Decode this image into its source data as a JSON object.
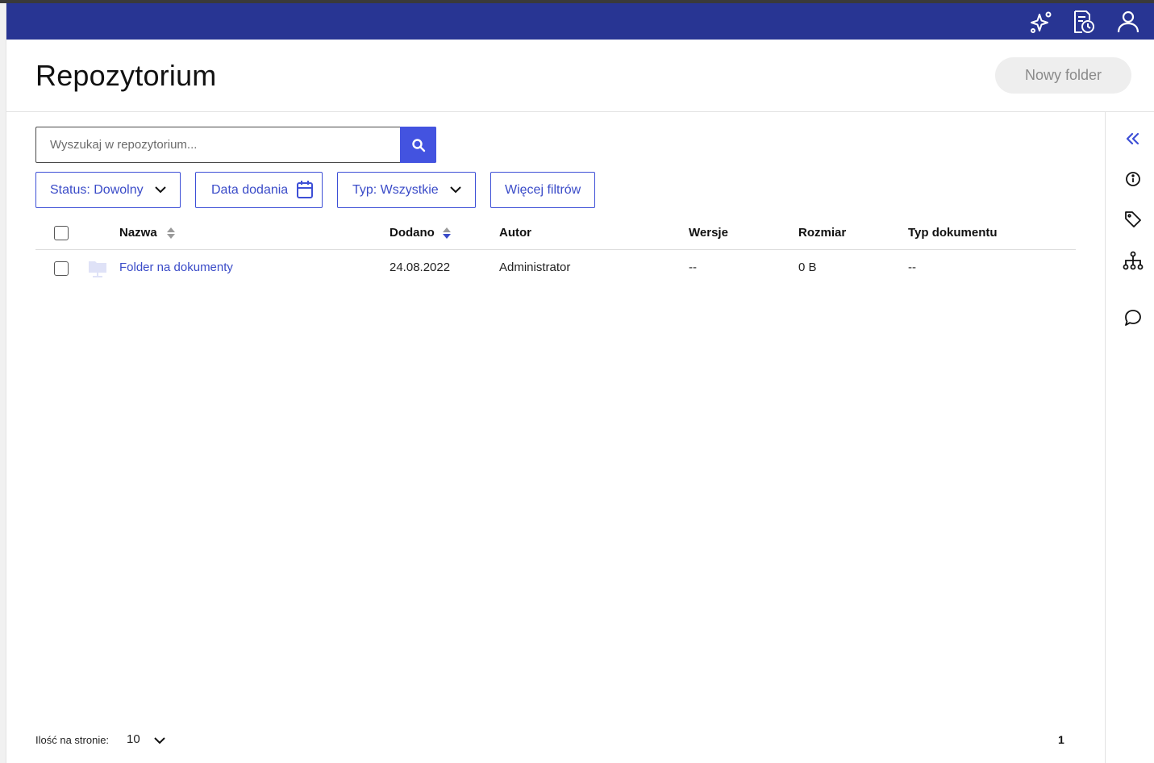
{
  "app": {
    "top_icons": [
      "sparkles-icon",
      "document-history-icon",
      "user-icon"
    ],
    "accent_color": "#283593",
    "link_color": "#3a4bc8",
    "primary_button_color": "#4353e0"
  },
  "header": {
    "title": "Repozytorium",
    "new_folder_label": "Nowy folder"
  },
  "search": {
    "placeholder": "Wyszukaj w repozytorium...",
    "value": ""
  },
  "filters": {
    "status_label": "Status: Dowolny",
    "date_label": "Data dodania",
    "type_label": "Typ: Wszystkie",
    "more_label": "Więcej filtrów"
  },
  "table": {
    "columns": [
      "Nazwa",
      "Dodano",
      "Autor",
      "Wersje",
      "Rozmiar",
      "Typ dokumentu"
    ],
    "rows": [
      {
        "name": "Folder na dokumenty",
        "added": "24.08.2022",
        "author": "Administrator",
        "versions": "--",
        "size": "0 B",
        "doc_type": "--"
      }
    ]
  },
  "side_panel": {
    "icons": [
      "collapse-double-chevron-icon",
      "info-icon",
      "tag-icon",
      "hierarchy-icon",
      "comment-icon"
    ]
  },
  "footer": {
    "per_page_label": "Ilość na stronie:",
    "per_page_value": "10",
    "current_page": "1"
  }
}
